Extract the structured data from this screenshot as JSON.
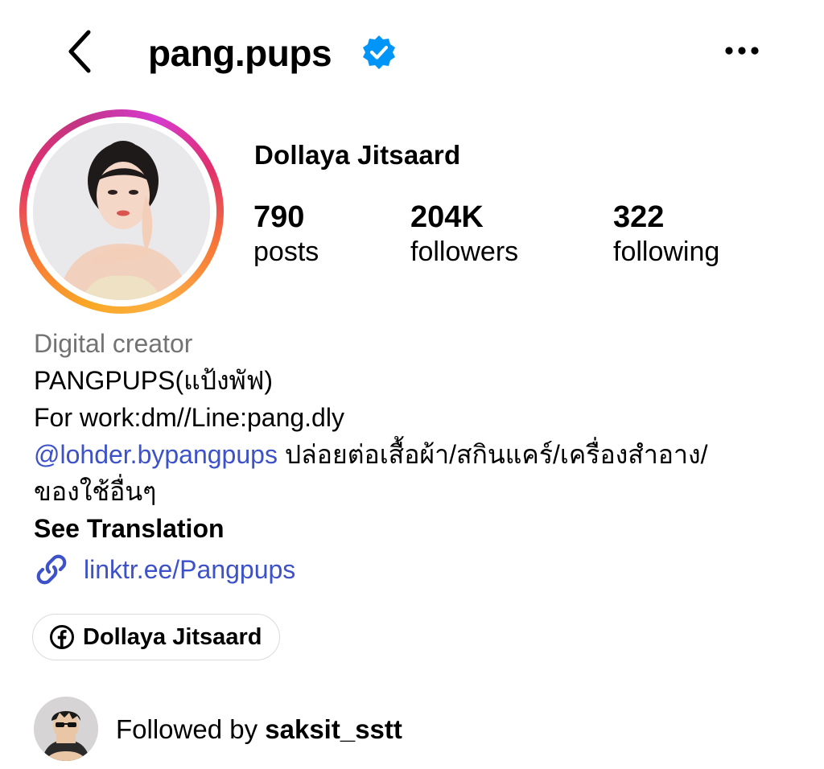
{
  "header": {
    "username": "pang.pups",
    "verified": true,
    "back_icon": "chevron-left-icon",
    "more_icon": "more-horizontal-icon"
  },
  "profile": {
    "full_name": "Dollaya Jitsaard",
    "stats": {
      "posts": {
        "value": "790",
        "label": "posts"
      },
      "followers": {
        "value": "204K",
        "label": "followers"
      },
      "following": {
        "value": "322",
        "label": "following"
      }
    }
  },
  "bio": {
    "category": "Digital creator",
    "line1": "PANGPUPS(แป้งพัฟ)",
    "line2": "For work:dm//Line:pang.dly",
    "mention": "@lohder.bypangpups",
    "line3_rest": " ปล่อยต่อเสื้อผ้า/สกินแคร์/เครื่องสำอาง/",
    "line4": "ของใช้อื่นๆ",
    "see_translation": "See Translation",
    "link": "linktr.ee/Pangpups"
  },
  "facebook_chip": {
    "label": "Dollaya Jitsaard"
  },
  "followed_by": {
    "prefix": "Followed by ",
    "user": "saksit_sstt"
  },
  "colors": {
    "link_blue": "#3d52c8",
    "verified_blue": "#0095f6",
    "muted_gray": "#737373",
    "chip_border": "#dbdbdb"
  }
}
